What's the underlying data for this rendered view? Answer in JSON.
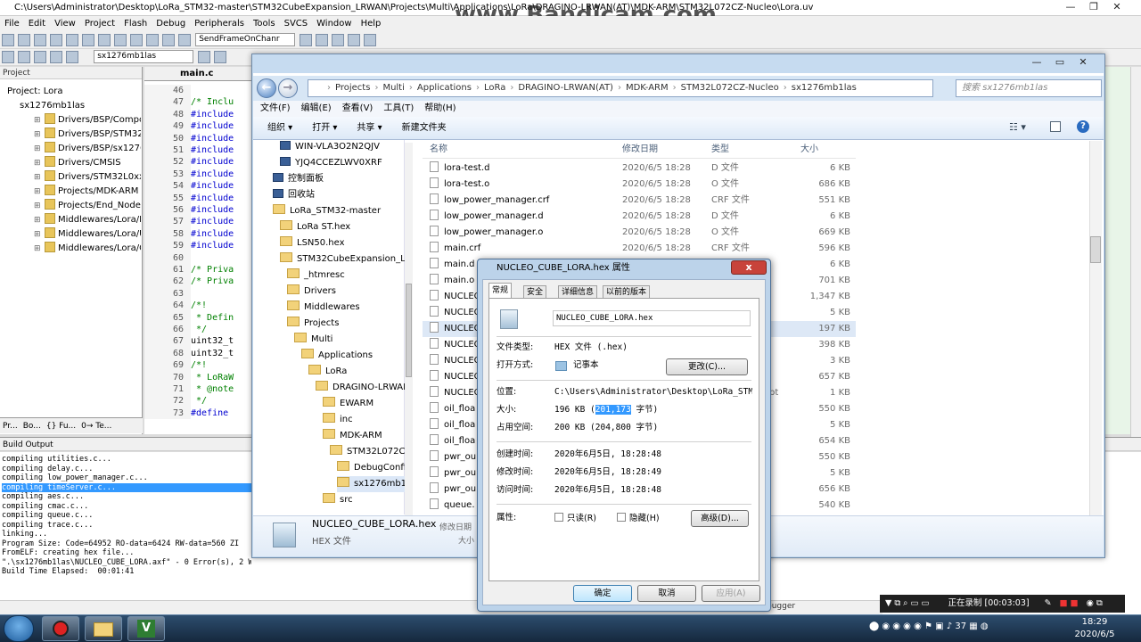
{
  "keil": {
    "title": "C:\\Users\\Administrator\\Desktop\\LoRa_STM32-master\\STM32CubeExpansion_LRWAN\\Projects\\Multi\\Applications\\LoRa\\DRAGINO-LRWAN(AT)\\MDK-ARM\\STM32L072CZ-Nucleo\\Lora.uv",
    "menu": [
      "File",
      "Edit",
      "View",
      "Project",
      "Flash",
      "Debug",
      "Peripherals",
      "Tools",
      "SVCS",
      "Window",
      "Help"
    ],
    "toolbar_combo1": "SendFrameOnChanr",
    "toolbar_target": "sx1276mb1las",
    "project_header": "Project",
    "tree": {
      "root": "Project: Lora",
      "target": "sx1276mb1las",
      "groups": [
        "Drivers/BSP/Compor",
        "Drivers/BSP/STM32L",
        "Drivers/BSP/sx1276m",
        "Drivers/CMSIS",
        "Drivers/STM32L0xx_I",
        "Projects/MDK-ARM",
        "Projects/End_Node",
        "Middlewares/Lora/M",
        "Middlewares/Lora/U",
        "Middlewares/Lora/C"
      ]
    },
    "panel_tabs": [
      "Pr...",
      "Bo...",
      "{} Fu...",
      "0→ Te..."
    ],
    "editor_tab": "main.c",
    "code": [
      {
        "n": "46",
        "t": "",
        "k": ""
      },
      {
        "n": "47",
        "t": "/* Inclu",
        "k": "c"
      },
      {
        "n": "48",
        "t": "#include",
        "k": "p"
      },
      {
        "n": "49",
        "t": "#include",
        "k": "p"
      },
      {
        "n": "50",
        "t": "#include",
        "k": "p"
      },
      {
        "n": "51",
        "t": "#include",
        "k": "p"
      },
      {
        "n": "52",
        "t": "#include",
        "k": "p"
      },
      {
        "n": "53",
        "t": "#include",
        "k": "p"
      },
      {
        "n": "54",
        "t": "#include",
        "k": "p"
      },
      {
        "n": "55",
        "t": "#include",
        "k": "p"
      },
      {
        "n": "56",
        "t": "#include",
        "k": "p"
      },
      {
        "n": "57",
        "t": "#include",
        "k": "p"
      },
      {
        "n": "58",
        "t": "#include",
        "k": "p"
      },
      {
        "n": "59",
        "t": "#include",
        "k": "p"
      },
      {
        "n": "60",
        "t": "",
        "k": ""
      },
      {
        "n": "61",
        "t": "/* Priva",
        "k": "c"
      },
      {
        "n": "62",
        "t": "/* Priva",
        "k": "c"
      },
      {
        "n": "63",
        "t": "",
        "k": ""
      },
      {
        "n": "64",
        "t": "/*!",
        "k": "c"
      },
      {
        "n": "65",
        "t": " * Defin",
        "k": "c"
      },
      {
        "n": "66",
        "t": " */",
        "k": "c"
      },
      {
        "n": "67",
        "t": "uint32_t",
        "k": ""
      },
      {
        "n": "68",
        "t": "uint32_t",
        "k": ""
      },
      {
        "n": "69",
        "t": "/*!",
        "k": "c"
      },
      {
        "n": "70",
        "t": " * LoRaW",
        "k": "c"
      },
      {
        "n": "71",
        "t": " * @note",
        "k": "c"
      },
      {
        "n": "72",
        "t": " */",
        "k": "c"
      },
      {
        "n": "73",
        "t": "#define",
        "k": "p"
      }
    ],
    "build_header": "Build Output",
    "build_lines": [
      "compiling utilities.c...",
      "compiling delay.c...",
      "compiling low_power_manager.c...",
      "compiling timeServer.c...",
      "compiling aes.c...",
      "compiling cmac.c...",
      "compiling queue.c...",
      "compiling trace.c...",
      "linking...",
      "Program Size: Code=64952 RO-data=6424 RW-data=560 ZI",
      "FromELF: creating hex file...",
      "\".\\sx1276mb1las\\NUCLEO_CUBE_LORA.axf\" - 0 Error(s), 2 Warning(s).",
      "Build Time Elapsed:  00:01:41"
    ],
    "build_selected_index": 3,
    "status_debugger": "bugger"
  },
  "watermark": "www.Bandicam.com",
  "explorer": {
    "breadcrumb": [
      "Projects",
      "Multi",
      "Applications",
      "LoRa",
      "DRAGINO-LRWAN(AT)",
      "MDK-ARM",
      "STM32L072CZ-Nucleo",
      "sx1276mb1las"
    ],
    "search_placeholder": "搜索 sx1276mb1las",
    "menu": [
      "文件(F)",
      "编辑(E)",
      "查看(V)",
      "工具(T)",
      "帮助(H)"
    ],
    "commands": [
      "组织 ▾",
      "打开 ▾",
      "共享 ▾",
      "新建文件夹"
    ],
    "nav": [
      {
        "label": "WIN-VLA3O2N2QJV",
        "kind": "pc",
        "indent": 0
      },
      {
        "label": "YJQ4CCEZLWV0XRF",
        "kind": "pc",
        "indent": 0
      },
      {
        "label": "控制面板",
        "kind": "pc",
        "indent": -8
      },
      {
        "label": "回收站",
        "kind": "pc",
        "indent": -8
      },
      {
        "label": "LoRa_STM32-master",
        "kind": "folder",
        "indent": -8
      },
      {
        "label": "LoRa ST.hex",
        "kind": "folder",
        "indent": 0
      },
      {
        "label": "LSN50.hex",
        "kind": "folder",
        "indent": 0
      },
      {
        "label": "STM32CubeExpansion_L",
        "kind": "folder",
        "indent": 0
      },
      {
        "label": "_htmresc",
        "kind": "folder",
        "indent": 8
      },
      {
        "label": "Drivers",
        "kind": "folder",
        "indent": 8
      },
      {
        "label": "Middlewares",
        "kind": "folder",
        "indent": 8
      },
      {
        "label": "Projects",
        "kind": "folder",
        "indent": 8
      },
      {
        "label": "Multi",
        "kind": "folder",
        "indent": 16
      },
      {
        "label": "Applications",
        "kind": "folder",
        "indent": 24
      },
      {
        "label": "LoRa",
        "kind": "folder",
        "indent": 32
      },
      {
        "label": "DRAGINO-LRWAN",
        "kind": "folder",
        "indent": 40
      },
      {
        "label": "EWARM",
        "kind": "folder",
        "indent": 48
      },
      {
        "label": "inc",
        "kind": "folder",
        "indent": 48
      },
      {
        "label": "MDK-ARM",
        "kind": "folder",
        "indent": 48
      },
      {
        "label": "STM32L072CZ-",
        "kind": "folder",
        "indent": 56
      },
      {
        "label": "DebugConfig",
        "kind": "folder",
        "indent": 64
      },
      {
        "label": "sx1276mb1las",
        "kind": "folder",
        "indent": 64
      },
      {
        "label": "src",
        "kind": "folder",
        "indent": 48
      }
    ],
    "nav_selected_index": 21,
    "columns": {
      "name": "名称",
      "date": "修改日期",
      "type": "类型",
      "size": "大小"
    },
    "files": [
      {
        "name": "lora-test.d",
        "date": "2020/6/5 18:28",
        "type": "D 文件",
        "size": "6 KB"
      },
      {
        "name": "lora-test.o",
        "date": "2020/6/5 18:28",
        "type": "O 文件",
        "size": "686 KB"
      },
      {
        "name": "low_power_manager.crf",
        "date": "2020/6/5 18:28",
        "type": "CRF 文件",
        "size": "551 KB"
      },
      {
        "name": "low_power_manager.d",
        "date": "2020/6/5 18:28",
        "type": "D 文件",
        "size": "6 KB"
      },
      {
        "name": "low_power_manager.o",
        "date": "2020/6/5 18:28",
        "type": "O 文件",
        "size": "669 KB"
      },
      {
        "name": "main.crf",
        "date": "2020/6/5 18:28",
        "type": "CRF 文件",
        "size": "596 KB"
      },
      {
        "name": "main.d",
        "date": "",
        "type": "",
        "size": "6 KB"
      },
      {
        "name": "main.o",
        "date": "",
        "type": "",
        "size": "701 KB"
      },
      {
        "name": "NUCLEO",
        "date": "",
        "type": "",
        "size": "1,347 KB"
      },
      {
        "name": "NUCLEO",
        "date": "",
        "type": "",
        "size": "5 KB"
      },
      {
        "name": "NUCLEO",
        "date": "",
        "type": "",
        "size": "197 KB"
      },
      {
        "name": "NUCLEO",
        "date": "",
        "type": "",
        "size": "398 KB"
      },
      {
        "name": "NUCLEO",
        "date": "",
        "type": "",
        "size": "3 KB"
      },
      {
        "name": "NUCLEO",
        "date": "",
        "type": "",
        "size": "657 KB"
      },
      {
        "name": "NUCLEO",
        "date": "",
        "type": "pt",
        "size": "1 KB"
      },
      {
        "name": "oil_floa",
        "date": "",
        "type": "",
        "size": "550 KB"
      },
      {
        "name": "oil_floa",
        "date": "",
        "type": "",
        "size": "5 KB"
      },
      {
        "name": "oil_floa",
        "date": "",
        "type": "",
        "size": "654 KB"
      },
      {
        "name": "pwr_ou",
        "date": "",
        "type": "",
        "size": "550 KB"
      },
      {
        "name": "pwr_ou",
        "date": "",
        "type": "",
        "size": "5 KB"
      },
      {
        "name": "pwr_ou",
        "date": "",
        "type": "",
        "size": "656 KB"
      },
      {
        "name": "queue.",
        "date": "",
        "type": "",
        "size": "540 KB"
      }
    ],
    "selected_file_index": 10,
    "details": {
      "name": "NUCLEO_CUBE_LORA.hex",
      "type": "HEX 文件",
      "modified_label": "修改日期",
      "size_label": "大小"
    }
  },
  "dialog": {
    "title": "NUCLEO_CUBE_LORA.hex 属性",
    "tabs": [
      "常规",
      "安全",
      "详细信息",
      "以前的版本"
    ],
    "filename": "NUCLEO_CUBE_LORA.hex",
    "type_label": "文件类型:",
    "type_value": "HEX 文件 (.hex)",
    "open_with_label": "打开方式:",
    "open_with_value": "记事本",
    "change_button": "更改(C)...",
    "location_label": "位置:",
    "location_value": "C:\\Users\\Administrator\\Desktop\\LoRa_STM32",
    "size_label": "大小:",
    "size_value_pre": "196 KB (",
    "size_value_hl": "201,173",
    "size_value_post": " 字节)",
    "disk_label": "占用空间:",
    "disk_value": "200 KB (204,800 字节)",
    "created_label": "创建时间:",
    "created_value": "2020年6月5日, 18:28:48",
    "modified_label": "修改时间:",
    "modified_value": "2020年6月5日, 18:28:49",
    "accessed_label": "访问时间:",
    "accessed_value": "2020年6月5日, 18:28:48",
    "attr_label": "属性:",
    "readonly": "只读(R)",
    "hidden": "隐藏(H)",
    "advanced": "高级(D)...",
    "ok": "确定",
    "cancel": "取消",
    "apply": "应用(A)"
  },
  "recorder": {
    "status": "正在录制 [00:03:03]"
  },
  "taskbar": {
    "time": "18:29",
    "date": "2020/6/5",
    "volume": "37"
  }
}
